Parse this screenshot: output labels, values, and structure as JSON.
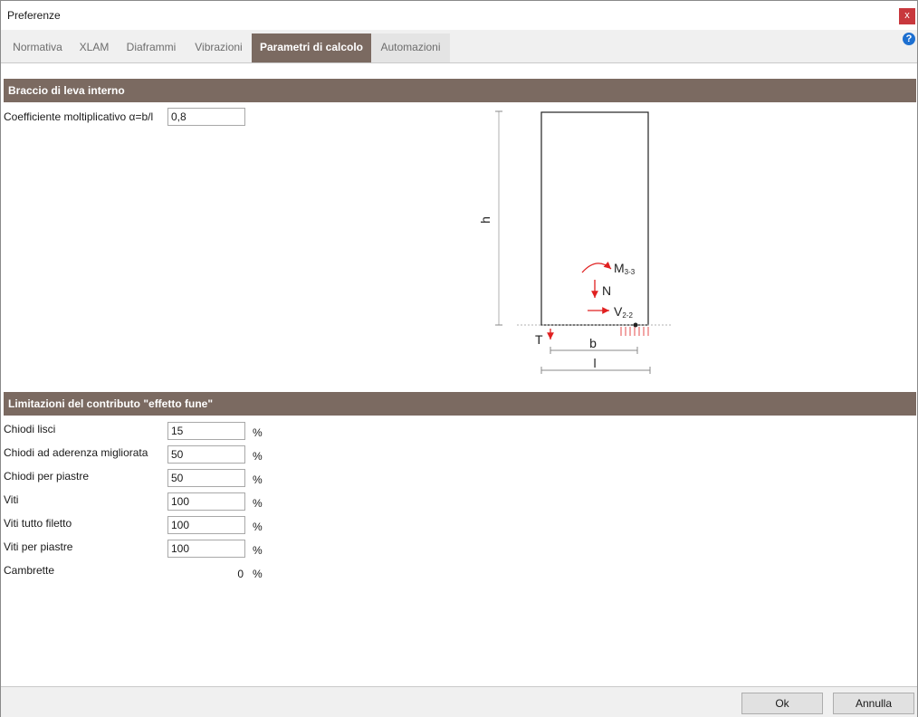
{
  "window": {
    "title": "Preferenze",
    "close_label": "x"
  },
  "tabs": [
    {
      "label": "Normativa",
      "active": false
    },
    {
      "label": "XLAM",
      "active": false
    },
    {
      "label": "Diaframmi",
      "active": false
    },
    {
      "label": "Vibrazioni",
      "active": false
    },
    {
      "label": "Parametri di calcolo",
      "active": true
    },
    {
      "label": "Automazioni",
      "active": false
    }
  ],
  "help_label": "?",
  "section1": {
    "title": "Braccio di leva interno",
    "coeff_label": "Coefficiente moltiplicativo α=b/l",
    "coeff_value": "0,8"
  },
  "diagram": {
    "h": "h",
    "m": "M",
    "m_sub": "3-3",
    "n": "N",
    "v": "V",
    "v_sub": "2-2",
    "t": "T",
    "b": "b",
    "l": "l",
    "accent_color": "#e02020"
  },
  "section2": {
    "title": "Limitazioni del contributo \"effetto fune\"",
    "unit": "%",
    "rows": [
      {
        "label": "Chiodi lisci",
        "value": "15"
      },
      {
        "label": "Chiodi ad aderenza migliorata",
        "value": "50"
      },
      {
        "label": "Chiodi per piastre",
        "value": "50"
      },
      {
        "label": "Viti",
        "value": "100"
      },
      {
        "label": "Viti tutto filetto",
        "value": "100"
      },
      {
        "label": "Viti per piastre",
        "value": "100"
      }
    ],
    "readonly": {
      "label": "Cambrette",
      "value": "0"
    }
  },
  "footer": {
    "ok_label": "Ok",
    "cancel_label": "Annulla"
  }
}
